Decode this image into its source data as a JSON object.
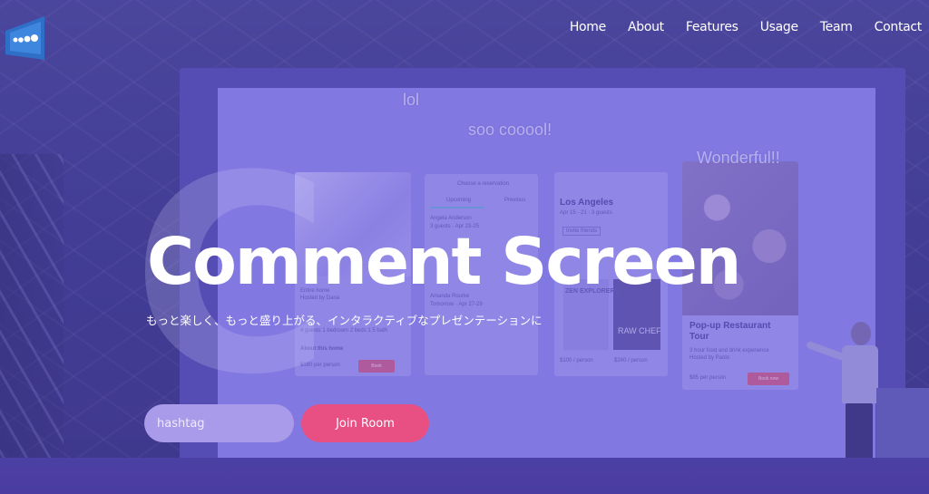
{
  "nav": {
    "items": [
      {
        "label": "Home"
      },
      {
        "label": "About"
      },
      {
        "label": "Features"
      },
      {
        "label": "Usage"
      },
      {
        "label": "Team"
      },
      {
        "label": "Contact"
      }
    ]
  },
  "brand": {
    "logo_icon": "screen-bubbles-logo-icon"
  },
  "hero": {
    "title": "Comment Screen",
    "subtitle": "もっと楽しく、もっと盛り上がる、インタラクティブなプレゼンテーションに"
  },
  "form": {
    "hashtag_placeholder": "hashtag",
    "hashtag_value": "",
    "join_label": "Join Room"
  },
  "comments": [
    {
      "text": "lol"
    },
    {
      "text": "soo cooool!"
    },
    {
      "text": "Wonderful!!"
    }
  ],
  "screen_cards": {
    "card1": {
      "lines": [
        "Entire home",
        "Hosted by Dana",
        "4 guests   1 bedroom   2 beds   1.5 bath",
        "About this home",
        "$160 per person",
        "Book"
      ]
    },
    "card2": {
      "lines": [
        "Choose a reservation",
        "Upcoming",
        "Previous",
        "Angela Anderson",
        "3 guests · Apr 23-25",
        "Amanda Rourke",
        "Tomorrow · Apr 27-29"
      ]
    },
    "card3": {
      "title": "Los Angeles",
      "lines": [
        "Apr 15 - 21 · 3 guests",
        "Invite friends",
        "ZEN EXPLORERS",
        "RAW CHEF",
        "$100 / person",
        "$240 / person"
      ]
    },
    "card4": {
      "title": "Pop-up Restaurant Tour",
      "lines": [
        "3 hour food and drink experience",
        "Hosted by Paolo",
        "$85 per person",
        "Book now"
      ]
    }
  },
  "colors": {
    "overlay": "#6a5fd6",
    "accent": "#e84f82",
    "input_bg": "#a99bea"
  }
}
